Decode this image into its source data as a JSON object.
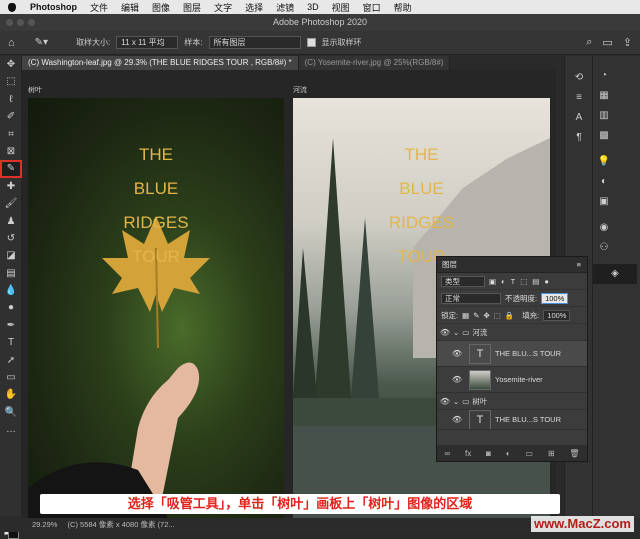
{
  "menubar": {
    "app": "Photoshop",
    "items": [
      "文件",
      "编辑",
      "图像",
      "图层",
      "文字",
      "选择",
      "滤镜",
      "3D",
      "视图",
      "窗口",
      "帮助"
    ]
  },
  "window": {
    "title": "Adobe Photoshop 2020"
  },
  "options": {
    "sample_size_label": "取样大小:",
    "sample_size_value": "11 x 11 平均",
    "sample_label": "样本:",
    "sample_value": "所有图层",
    "show_ring_label": "显示取样环"
  },
  "tabs": [
    {
      "label": "(C) Washington-leaf.jpg @ 29.3% (THE BLUE RIDGES TOUR , RGB/8#) *"
    },
    {
      "label": "(C) Yosemite-river.jpg @ 25%(RGB/8#)"
    }
  ],
  "artboards": [
    {
      "label": "树叶"
    },
    {
      "label": "河流"
    }
  ],
  "overlay_text": [
    "THE",
    "BLUE",
    "RIDGES",
    "TOUR"
  ],
  "layers_panel": {
    "title": "图层",
    "filter": "类型",
    "blend": "正常",
    "opacity_label": "不透明度:",
    "opacity": "100%",
    "lock_label": "锁定:",
    "fill_label": "填充:",
    "fill": "100%",
    "groups": [
      {
        "name": "河流",
        "layers": [
          {
            "name": "THE BLU...S TOUR",
            "type": "T"
          },
          {
            "name": "Yosemite-river",
            "type": "img"
          }
        ]
      },
      {
        "name": "树叶",
        "layers": [
          {
            "name": "THE BLU...S TOUR",
            "type": "T"
          }
        ]
      }
    ]
  },
  "status": {
    "zoom": "29.29%",
    "info": "(C) 5584 像素 x 4080 像素 (72..."
  },
  "caption": "选择「吸管工具」，单击「树叶」画板上「树叶」图像的区域",
  "watermark": "www.MacZ.com"
}
